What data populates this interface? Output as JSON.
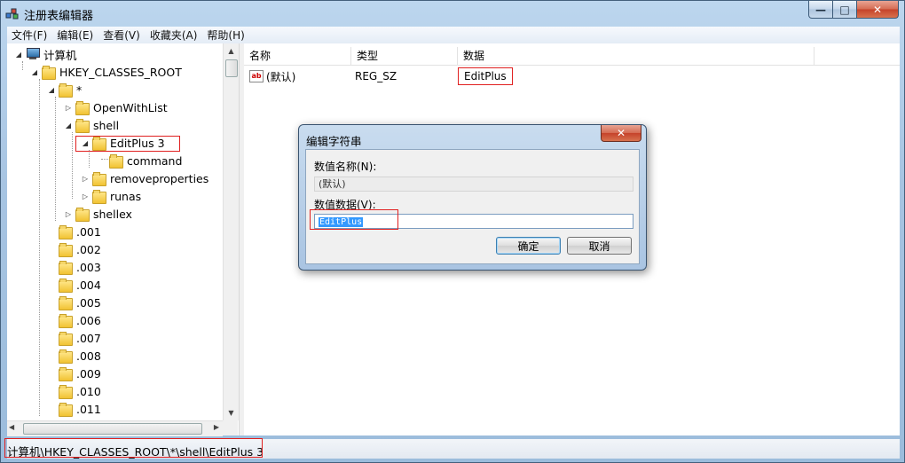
{
  "window": {
    "title": "注册表编辑器",
    "icon": "regedit-icon",
    "controls": {
      "minimize": "—",
      "maximize": "□",
      "close": "✕"
    }
  },
  "menu": {
    "items": [
      "文件(F)",
      "编辑(E)",
      "查看(V)",
      "收藏夹(A)",
      "帮助(H)"
    ]
  },
  "tree": {
    "items": [
      {
        "label": "计算机",
        "icon": "computer-icon",
        "expander": "◢"
      },
      {
        "label": "HKEY_CLASSES_ROOT",
        "icon": "folder-icon",
        "expander": "◢"
      },
      {
        "label": "*",
        "icon": "folder-icon",
        "expander": "◢"
      },
      {
        "label": "OpenWithList",
        "icon": "folder-icon",
        "expander": "▷"
      },
      {
        "label": "shell",
        "icon": "folder-icon",
        "expander": "◢"
      },
      {
        "label": "EditPlus 3",
        "icon": "folder-icon",
        "expander": "◢"
      },
      {
        "label": "command",
        "icon": "folder-icon",
        "expander": ""
      },
      {
        "label": "removeproperties",
        "icon": "folder-icon",
        "expander": "▷"
      },
      {
        "label": "runas",
        "icon": "folder-icon",
        "expander": "▷"
      },
      {
        "label": "shellex",
        "icon": "folder-icon",
        "expander": "▷"
      },
      {
        "label": ".001",
        "icon": "folder-icon",
        "expander": ""
      },
      {
        "label": ".002",
        "icon": "folder-icon",
        "expander": ""
      },
      {
        "label": ".003",
        "icon": "folder-icon",
        "expander": ""
      },
      {
        "label": ".004",
        "icon": "folder-icon",
        "expander": ""
      },
      {
        "label": ".005",
        "icon": "folder-icon",
        "expander": ""
      },
      {
        "label": ".006",
        "icon": "folder-icon",
        "expander": ""
      },
      {
        "label": ".007",
        "icon": "folder-icon",
        "expander": ""
      },
      {
        "label": ".008",
        "icon": "folder-icon",
        "expander": ""
      },
      {
        "label": ".009",
        "icon": "folder-icon",
        "expander": ""
      },
      {
        "label": ".010",
        "icon": "folder-icon",
        "expander": ""
      },
      {
        "label": ".011",
        "icon": "folder-icon",
        "expander": ""
      }
    ]
  },
  "listview": {
    "columns": [
      "名称",
      "类型",
      "数据"
    ],
    "rows": [
      {
        "name": "(默认)",
        "type": "REG_SZ",
        "data": "EditPlus",
        "icon": "ab-string-icon"
      }
    ]
  },
  "dialog": {
    "title": "编辑字符串",
    "close": "✕",
    "name_label": "数值名称(N):",
    "name_value": "(默认)",
    "data_label": "数值数据(V):",
    "data_value": "EditPlus",
    "ok": "确定",
    "cancel": "取消"
  },
  "status": {
    "path": "计算机\\HKEY_CLASSES_ROOT\\*\\shell\\EditPlus 3"
  },
  "colors": {
    "highlight_box": "#e02020",
    "selection": "#3399ff"
  }
}
